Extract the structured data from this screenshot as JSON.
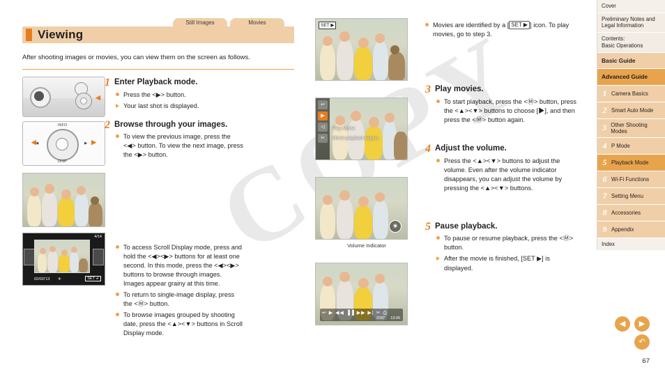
{
  "watermark": "COPY",
  "top_tabs": [
    {
      "label": "Still Images"
    },
    {
      "label": "Movies"
    }
  ],
  "header": {
    "title": "Viewing",
    "intro": "After shooting images or movies, you can view them on the screen as follows."
  },
  "steps": [
    {
      "num": "1",
      "title": "Enter Playback mode.",
      "bullets": [
        {
          "type": "dot",
          "text": "Press the <▶> button."
        },
        {
          "type": "arrow",
          "text": "Your last shot is displayed."
        }
      ]
    },
    {
      "num": "2",
      "title": "Browse through your images.",
      "bullets": [
        {
          "type": "dot",
          "text": "To view the previous image, press the <◀> button. To view the next image, press the <▶> button."
        }
      ]
    },
    {
      "num": "3",
      "title": "Play movies.",
      "bullets": [
        {
          "type": "dot",
          "text": "To start playback, press the <Ⓜ> button, press the <▲><▼> buttons to choose [▶], and then press the <Ⓜ> button again."
        }
      ]
    },
    {
      "num": "4",
      "title": "Adjust the volume.",
      "bullets": [
        {
          "type": "dot",
          "text": "Press the <▲><▼> buttons to adjust the volume. Even after the volume indicator disappears, you can adjust the volume by pressing the <▲><▼> buttons."
        }
      ]
    },
    {
      "num": "5",
      "title": "Pause playback.",
      "bullets": [
        {
          "type": "dot",
          "text": "To pause or resume playback, press the <Ⓜ> button."
        },
        {
          "type": "arrow",
          "text": "After the movie is finished, [SET ▶] is displayed."
        }
      ]
    }
  ],
  "scroll_bullets": [
    {
      "type": "dot",
      "text": "To access Scroll Display mode, press and hold the <◀><▶> buttons for at least one second. In this mode, press the <◀><▶> buttons to browse through images. Images appear grainy at this time."
    },
    {
      "type": "dot",
      "text": "To return to single-image display, press the <Ⓜ> button."
    },
    {
      "type": "dot",
      "text": "To browse images grouped by shooting date, press the <▲><▼> buttons in Scroll Display mode."
    }
  ],
  "movie_note": {
    "text_before": "Movies are identified by a [",
    "badge": "SET ▶",
    "text_after": "] icon. To play movies, go to step 3."
  },
  "captions": {
    "volume_indicator": "Volume Indicator"
  },
  "screens": {
    "set_badge": "SET ▶",
    "movie_menu_label1": "Play Movie",
    "movie_menu_label2": "Movie playback begins",
    "index_count": "4/14",
    "index_date": "02/02/'13",
    "index_set": "SET ↲",
    "playback_time_current": "0'00\"",
    "playback_time_total": "13:00"
  },
  "sidebar": {
    "items": [
      {
        "label": "Cover",
        "style": "plain"
      },
      {
        "label": "Preliminary Notes and Legal Information",
        "style": "normal"
      },
      {
        "label": "Contents:\nBasic Operations",
        "style": "normal"
      },
      {
        "label": "Basic Guide",
        "style": "guide"
      },
      {
        "label": "Advanced Guide",
        "style": "active"
      }
    ],
    "chapters": [
      {
        "num": "1",
        "label": "Camera Basics",
        "active": false
      },
      {
        "num": "2",
        "label": "Smart Auto Mode",
        "active": false
      },
      {
        "num": "3",
        "label": "Other Shooting Modes",
        "active": false
      },
      {
        "num": "4",
        "label": "P Mode",
        "active": false
      },
      {
        "num": "5",
        "label": "Playback Mode",
        "active": true
      },
      {
        "num": "6",
        "label": "Wi-Fi Functions",
        "active": false
      },
      {
        "num": "7",
        "label": "Setting Menu",
        "active": false
      },
      {
        "num": "8",
        "label": "Accessories",
        "active": false
      },
      {
        "num": "9",
        "label": "Appendix",
        "active": false
      }
    ],
    "index": {
      "label": "Index"
    }
  },
  "nav": {
    "prev": "◀",
    "next": "▶",
    "back": "↶",
    "page_number": "67"
  },
  "colors": {
    "accent": "#e8a44c",
    "accent_strong": "#e87d1e",
    "tab_bg": "#f0cfa8",
    "text": "#231f20"
  }
}
